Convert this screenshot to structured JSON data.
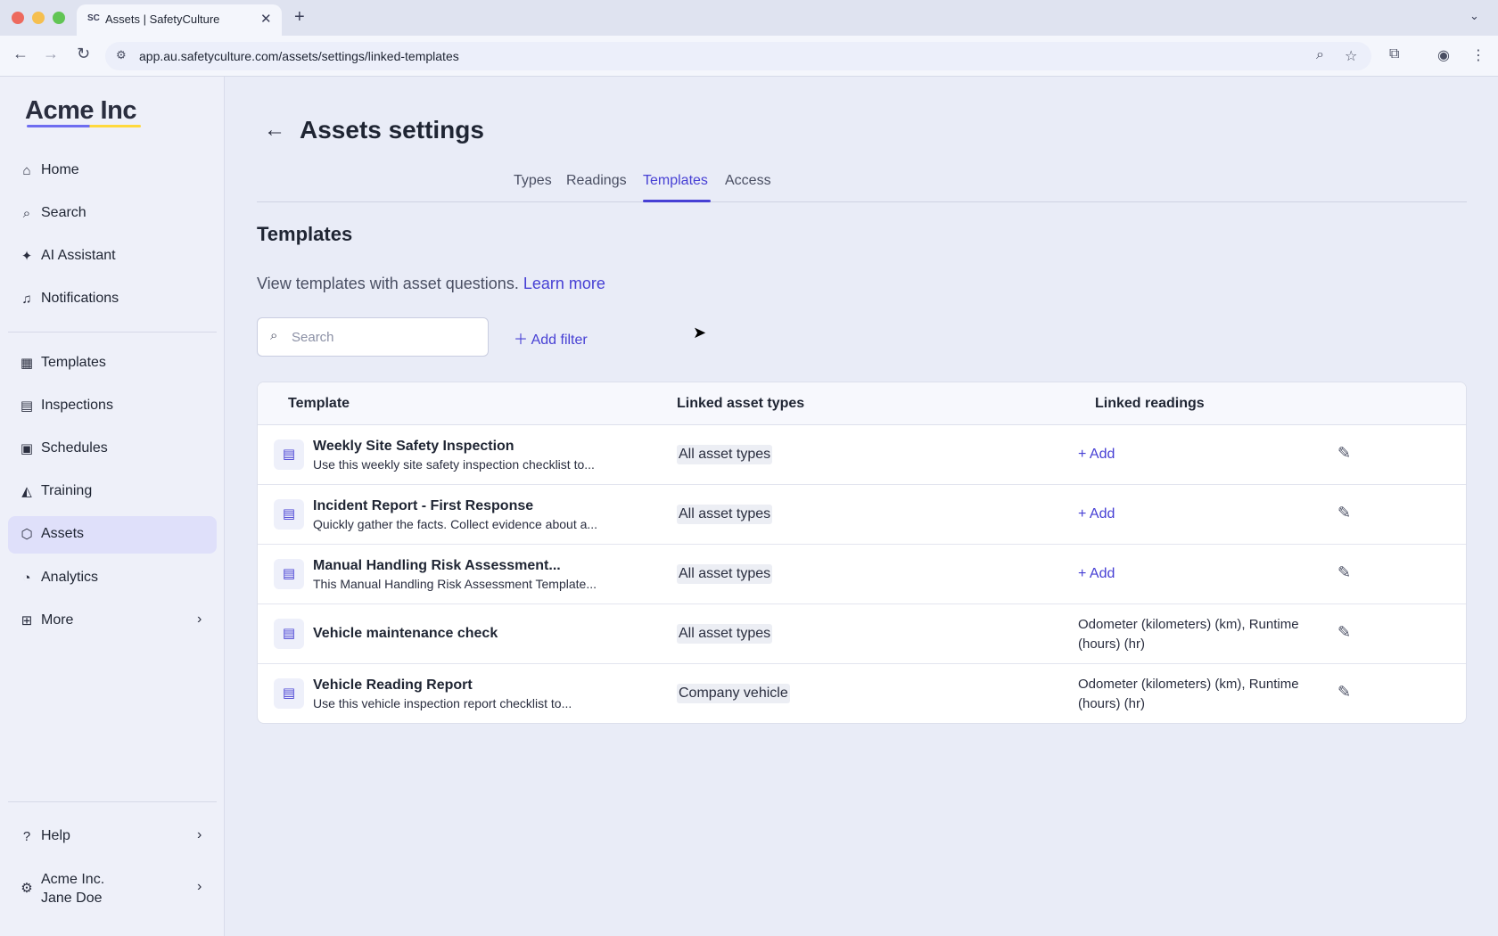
{
  "browser": {
    "tab_title": "Assets | SafetyCulture",
    "favicon_text": "SC",
    "url": "app.au.safetyculture.com/assets/settings/linked-templates"
  },
  "sidebar": {
    "logo": "Acme Inc",
    "items": [
      {
        "label": "Home",
        "icon": "home-icon"
      },
      {
        "label": "Search",
        "icon": "search-icon"
      },
      {
        "label": "AI Assistant",
        "icon": "sparkle-icon"
      },
      {
        "label": "Notifications",
        "icon": "bell-icon"
      },
      {
        "label": "Templates",
        "icon": "template-icon"
      },
      {
        "label": "Inspections",
        "icon": "clipboard-icon"
      },
      {
        "label": "Schedules",
        "icon": "calendar-icon"
      },
      {
        "label": "Training",
        "icon": "graduation-icon"
      },
      {
        "label": "Assets",
        "icon": "cube-icon",
        "active": true
      },
      {
        "label": "Analytics",
        "icon": "chart-icon"
      },
      {
        "label": "More",
        "icon": "grid-icon"
      }
    ],
    "help": "Help",
    "account": {
      "org": "Acme Inc.",
      "user": "Jane Doe"
    }
  },
  "page": {
    "title": "Assets settings",
    "tabs": [
      "Types",
      "Readings",
      "Templates",
      "Access"
    ],
    "active_tab": "Templates",
    "section_title": "Templates",
    "description": "View templates with asset questions.",
    "learn_more": "Learn more",
    "search_placeholder": "Search",
    "add_filter": "Add filter"
  },
  "table": {
    "columns": [
      "Template",
      "Linked asset types",
      "Linked readings"
    ],
    "rows": [
      {
        "name": "Weekly Site Safety Inspection",
        "subtitle": "Use this weekly site safety inspection checklist to...",
        "asset_types": "All asset types",
        "readings": "+ Add"
      },
      {
        "name": "Incident Report - First Response",
        "subtitle": "Quickly gather the facts. Collect evidence about a...",
        "asset_types": "All asset types",
        "readings": "+ Add"
      },
      {
        "name": "Manual Handling Risk Assessment...",
        "subtitle": "This Manual Handling Risk Assessment Template...",
        "asset_types": "All asset types",
        "readings": "+ Add"
      },
      {
        "name": "Vehicle maintenance check",
        "subtitle": "",
        "asset_types": "All asset types",
        "readings": "Odometer (kilometers) (km), Runtime (hours) (hr)"
      },
      {
        "name": "Vehicle Reading Report",
        "subtitle": "Use this vehicle inspection report checklist to...",
        "asset_types": "Company vehicle",
        "readings": "Odometer (kilometers) (km), Runtime (hours) (hr)"
      }
    ]
  },
  "colors": {
    "accent": "#4740d4",
    "active_nav_bg": "#dfe0fa",
    "page_bg": "#e9ecf7"
  }
}
